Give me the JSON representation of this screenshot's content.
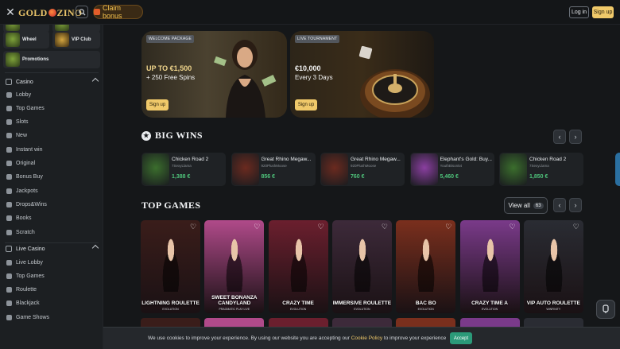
{
  "header": {
    "logo": {
      "part1": "GOLD",
      "part2": "ZINO"
    },
    "claim_label": "Claim bonus",
    "login_label": "Log in",
    "signup_label": "Sign up"
  },
  "sidebar": {
    "tiles": [
      {
        "label": ""
      },
      {
        "label": ""
      },
      {
        "label": "Wheel"
      },
      {
        "label": "VIP Club"
      },
      {
        "label": "Promotions"
      }
    ],
    "casino": {
      "title": "Casino",
      "items": [
        "Lobby",
        "Top Games",
        "Slots",
        "New",
        "Instant win",
        "Original",
        "Bonus Buy",
        "Jackpots",
        "Drops&Wins",
        "Books",
        "Scratch"
      ]
    },
    "live": {
      "title": "Live Casino",
      "items": [
        "Live Lobby",
        "Top Games",
        "Roulette",
        "Blackjack",
        "Game Shows"
      ]
    }
  },
  "banners": [
    {
      "tag": "WELCOME PACKAGE",
      "line1": "UP TO €1,500",
      "line2": "+ 250 Free Spins",
      "cta": "Sign up"
    },
    {
      "tag": "LIVE TOURNAMENT",
      "line1": "€10,000",
      "line2": "Every 3 Days",
      "cta": "Sign up"
    }
  ],
  "big_wins": {
    "title": "BIG WINS",
    "items": [
      {
        "game": "Chicken Road 2",
        "user": "7SexyLlama",
        "amount": "1,388 €",
        "color": "#3b6e2d"
      },
      {
        "game": "Great Rhino Megaw...",
        "user": "920PlushMoose",
        "amount": "856 €",
        "color": "#6b2a1f"
      },
      {
        "game": "Great Rhino Megaw...",
        "user": "920PlushMoose",
        "amount": "760 €",
        "color": "#6b2a1f"
      },
      {
        "game": "Elephant's Gold: Buy...",
        "user": "YouthBison54",
        "amount": "5,460 €",
        "color": "#8a3fa0"
      },
      {
        "game": "Chicken Road 2",
        "user": "7SexyLlama",
        "amount": "1,850 €",
        "color": "#3b6e2d"
      }
    ]
  },
  "top_games": {
    "title": "TOP GAMES",
    "view_all": "View all",
    "count": "63",
    "cards": [
      {
        "title": "LIGHTNING ROULETTE",
        "provider": "EVOLUTION",
        "bg": "#3a1d1a"
      },
      {
        "title": "SWEET BONANZA CANDYLAND",
        "provider": "PRAGMATIC PLAY LIVE",
        "bg": "#b04a8a"
      },
      {
        "title": "CRAZY TIME",
        "provider": "EVOLUTION",
        "bg": "#6b1f2e"
      },
      {
        "title": "IMMERSIVE ROULETTE",
        "provider": "EVOLUTION",
        "bg": "#3d2a3a"
      },
      {
        "title": "BAC BO",
        "provider": "EVOLUTION",
        "bg": "#7a2f1d"
      },
      {
        "title": "CRAZY TIME A",
        "provider": "EVOLUTION",
        "bg": "#7a3a8a"
      },
      {
        "title": "VIP AUTO ROULETTE",
        "provider": "WINFINITY",
        "bg": "#2a2c33"
      }
    ]
  },
  "cookie": {
    "text1": "We use cookies to improve your experience. By using our website you are accepting our ",
    "link": "Cookie Policy",
    "text2": " to improve your experience",
    "accept": "Accept"
  }
}
